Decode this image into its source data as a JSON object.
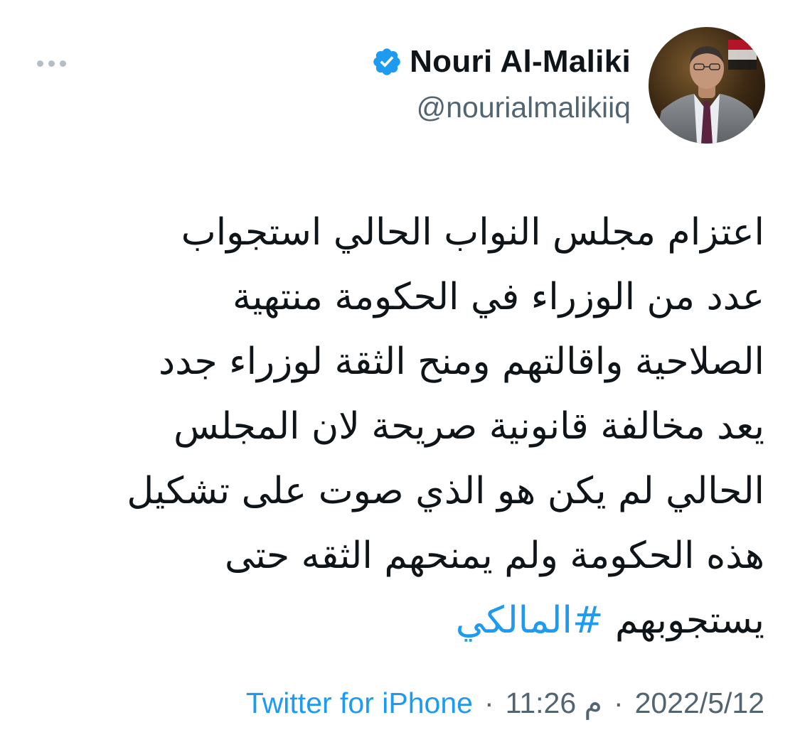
{
  "tweet": {
    "author": {
      "display_name": "Nouri Al-Maliki",
      "handle": "@nourialmalikiiq",
      "verified": true,
      "verified_icon": "verified-badge-icon",
      "avatar": "profile-photo"
    },
    "more_icon": "more-horizontal-icon",
    "text_lines": [
      "اعتزام مجلس النواب الحالي استجواب",
      "عدد من الوزراء في الحكومة منتهية",
      "الصلاحية واقالتهم ومنح الثقة لوزراء جدد",
      "يعد مخالفة قانونية صريحة لان المجلس",
      "الحالي لم يكن هو الذي صوت على تشكيل",
      "هذه الحكومة ولم يمنحهم الثقه حتى",
      "يستجوبهم"
    ],
    "hashtag": "#المالكي",
    "date": "2022/5/12",
    "time": "11:26 م",
    "separator": "·",
    "source": "Twitter for iPhone"
  },
  "colors": {
    "text": "#0f1419",
    "secondary": "#536471",
    "accent": "#1d9bf0"
  }
}
